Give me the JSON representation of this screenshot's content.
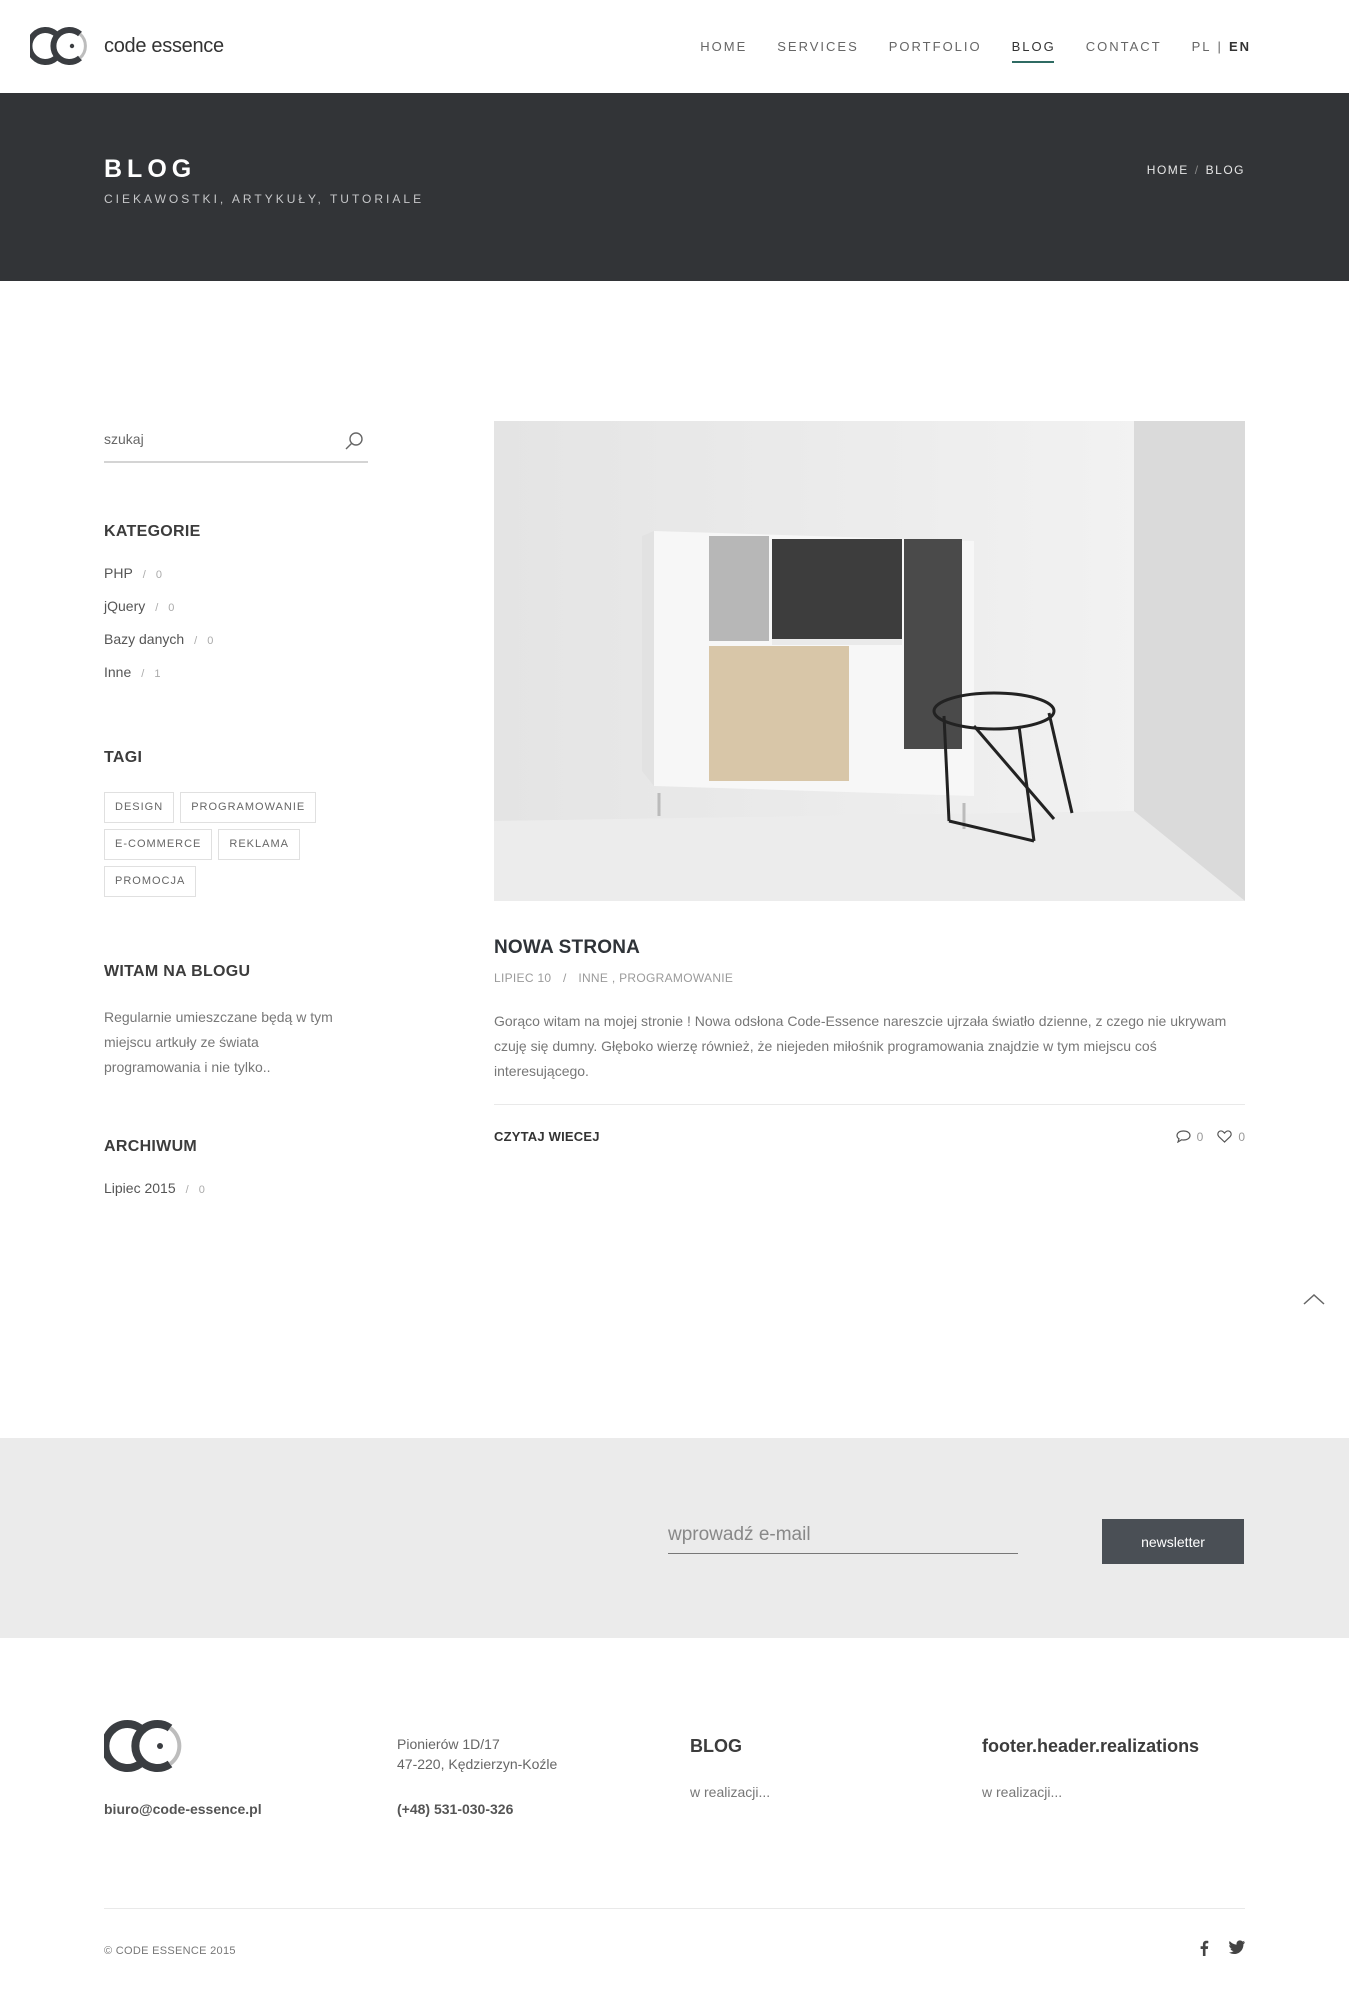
{
  "header": {
    "logo_text": "code essence",
    "nav": [
      "HOME",
      "SERVICES",
      "PORTFOLIO",
      "BLOG",
      "CONTACT"
    ],
    "active_nav": "BLOG",
    "lang_pl": "PL",
    "lang_sep": "|",
    "lang_en": "EN"
  },
  "title_band": {
    "title": "BLOG",
    "subtitle": "CIEKAWOSTKI, ARTYKUŁY, TUTORIALE",
    "breadcrumb_home": "HOME",
    "breadcrumb_sep": "/",
    "breadcrumb_current": "BLOG"
  },
  "sidebar": {
    "search_placeholder": "szukaj",
    "categories_title": "KATEGORIE",
    "categories": [
      {
        "name": "PHP",
        "count": "0"
      },
      {
        "name": "jQuery",
        "count": "0"
      },
      {
        "name": "Bazy danych",
        "count": "0"
      },
      {
        "name": "Inne",
        "count": "1"
      }
    ],
    "tags_title": "TAGI",
    "tags": [
      "DESIGN",
      "PROGRAMOWANIE",
      "E-COMMERCE",
      "REKLAMA",
      "PROMOCJA"
    ],
    "about_title": "WITAM NA BLOGU",
    "about_text": "Regularnie umieszczane będą w tym miejscu artkuły ze świata programowania i nie tylko..",
    "archive_title": "ARCHIWUM",
    "archive": [
      {
        "name": "Lipiec 2015",
        "count": "0"
      }
    ],
    "count_sep": "/"
  },
  "post": {
    "title": "NOWA STRONA",
    "date": "LIPIEC 10",
    "meta_sep": "/",
    "categories": "INNE , PROGRAMOWANIE",
    "excerpt": "Gorąco witam na mojej stronie ! Nowa odsłona Code-Essence nareszcie ujrzała światło dzienne, z czego nie ukrywam czuję się dumny. Głęboko wierzę również, że niejeden miłośnik programowania znajdzie w tym miejscu coś interesującego.",
    "read_more": "CZYTAJ WIECEJ",
    "comments": "0",
    "likes": "0"
  },
  "newsletter": {
    "placeholder": "wprowadź e-mail",
    "button": "newsletter"
  },
  "footer": {
    "email": "biuro@code-essence.pl",
    "address_line1": "Pionierów 1D/17",
    "address_line2": "47-220, Kędzierzyn-Koźle",
    "phone": "(+48) 531-030-326",
    "blog_title": "BLOG",
    "blog_text": "w realizacji...",
    "realizations_title": "footer.header.realizations",
    "realizations_text": "w realizacji...",
    "copyright": "© CODE ESSENCE 2015"
  },
  "colors": {
    "title_band_bg": "#323437",
    "accent_underline": "#2f6b63",
    "newsletter_bg": "#ebebeb",
    "newsletter_button": "#4a4f55"
  },
  "icons": [
    "search-icon",
    "comment-icon",
    "heart-icon",
    "chevron-up-icon",
    "facebook-icon",
    "twitter-icon"
  ]
}
